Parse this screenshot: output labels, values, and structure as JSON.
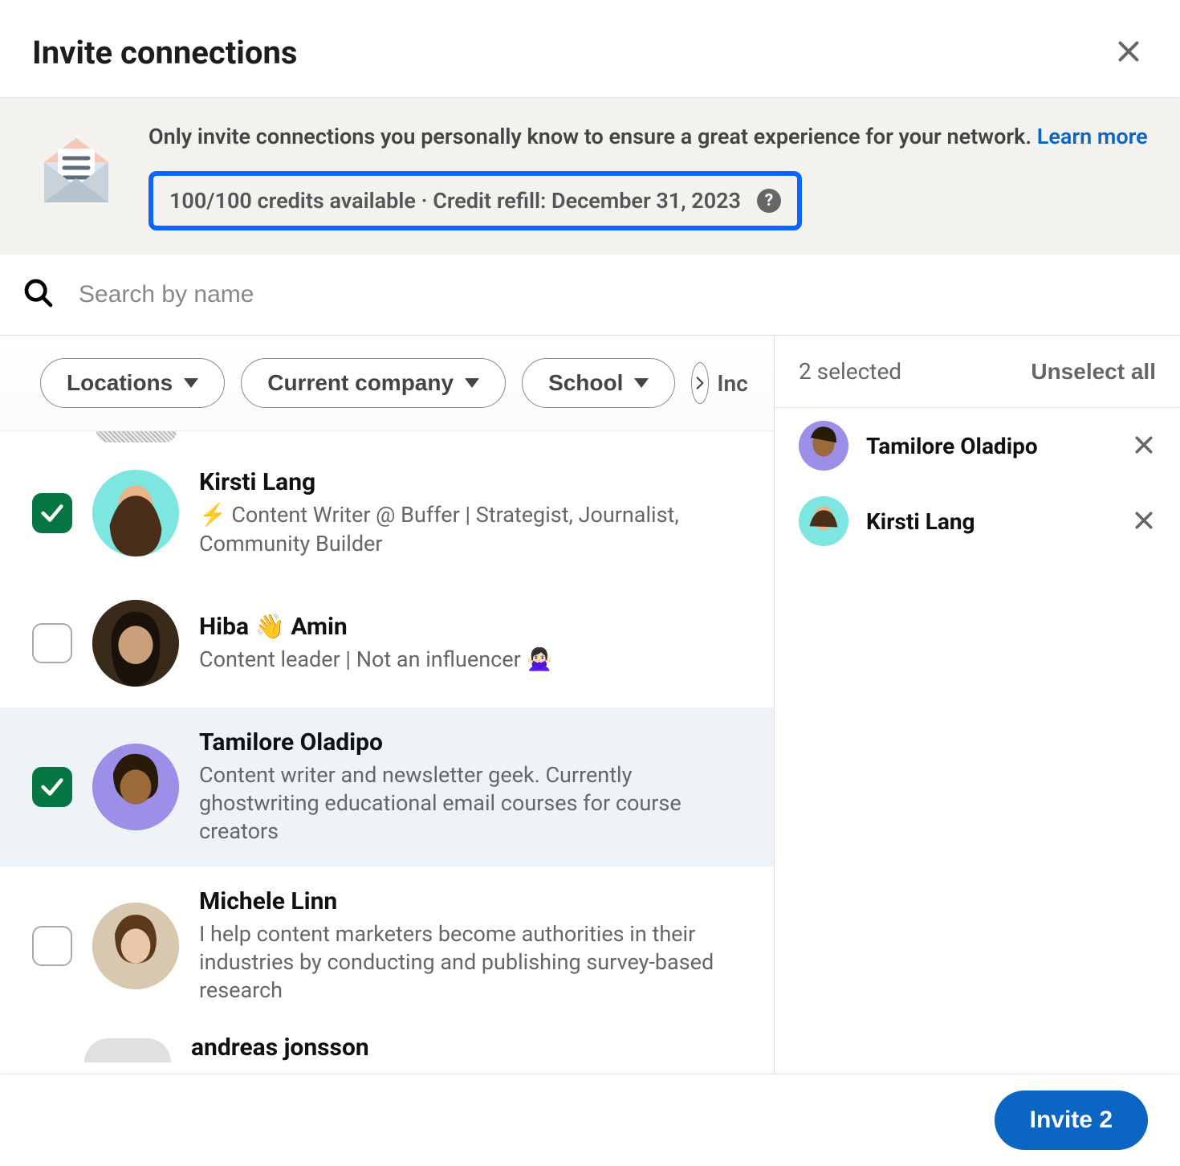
{
  "header": {
    "title": "Invite connections"
  },
  "banner": {
    "text": "Only invite connections you personally know to ensure a great experience for your network.",
    "learn_more": "Learn more",
    "credits": "100/100 credits available · Credit refill: December 31, 2023"
  },
  "search": {
    "placeholder": "Search by name"
  },
  "filters": {
    "locations": "Locations",
    "company": "Current company",
    "school": "School",
    "partial": "Inc"
  },
  "list": [
    {
      "name": "Kirsti Lang",
      "desc": "⚡ Content Writer @ Buffer | Strategist, Journalist, Community Builder",
      "checked": true,
      "avatar_bg": "#7ee6e0"
    },
    {
      "name": "Hiba 👋 Amin",
      "desc": "Content leader | Not an influencer 🙅🏻‍♀️",
      "checked": false,
      "avatar_bg": "#4a3a2a"
    },
    {
      "name": "Tamilore Oladipo",
      "desc": "Content writer and newsletter geek. Currently ghostwriting educational email courses for course creators",
      "checked": true,
      "avatar_bg": "#9d8ee8"
    },
    {
      "name": "Michele Linn",
      "desc": "I help content marketers become authorities in their industries by conducting and publishing survey-based research",
      "checked": false,
      "avatar_bg": "#c9a27a"
    },
    {
      "name": "andreas jonsson",
      "desc": "",
      "checked": false,
      "avatar_bg": "#d0d0d0"
    }
  ],
  "right": {
    "count_label": "2 selected",
    "unselect": "Unselect all",
    "selected": [
      {
        "name": "Tamilore Oladipo",
        "avatar_bg": "#9d8ee8"
      },
      {
        "name": "Kirsti Lang",
        "avatar_bg": "#7ee6e0"
      }
    ]
  },
  "footer": {
    "invite_label": "Invite 2"
  }
}
